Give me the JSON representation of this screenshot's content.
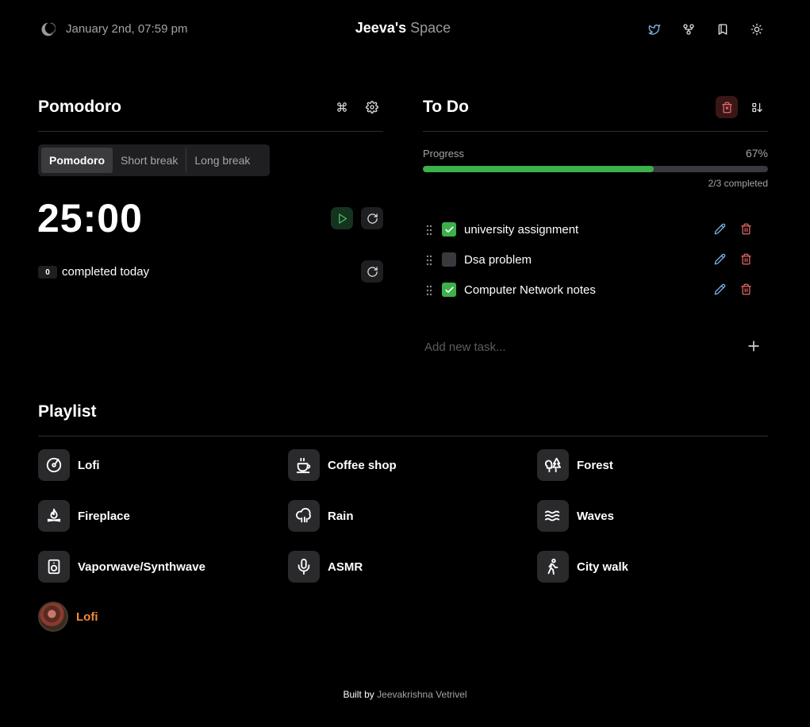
{
  "header": {
    "date": "January 2nd, 07:59 pm",
    "title_main": "Jeeva's",
    "title_sub": "Space",
    "icons": [
      "moon-logo-icon",
      "twitter-icon",
      "git-fork-icon",
      "bookmark-icon",
      "sun-icon"
    ]
  },
  "pomodoro": {
    "title": "Pomodoro",
    "tabs": [
      "Pomodoro",
      "Short break",
      "Long break"
    ],
    "active_tab": "Pomodoro",
    "timer": "25:00",
    "completed_count": "0",
    "completed_label": "completed today"
  },
  "todo": {
    "title": "To Do",
    "progress_label": "Progress",
    "progress_percent_text": "67%",
    "progress_value": 0.67,
    "completed_text": "2/3 completed",
    "tasks": [
      {
        "text": "university assignment",
        "done": true
      },
      {
        "text": "Dsa problem",
        "done": false
      },
      {
        "text": "Computer Network notes",
        "done": true
      }
    ],
    "add_placeholder": "Add new task..."
  },
  "playlist": {
    "title": "Playlist",
    "items": [
      {
        "label": "Lofi",
        "icon": "disc-icon"
      },
      {
        "label": "Coffee shop",
        "icon": "coffee-icon"
      },
      {
        "label": "Forest",
        "icon": "trees-icon"
      },
      {
        "label": "Fireplace",
        "icon": "flame-icon"
      },
      {
        "label": "Rain",
        "icon": "cloud-rain-icon"
      },
      {
        "label": "Waves",
        "icon": "waves-icon"
      },
      {
        "label": "Vaporwave/Synthwave",
        "icon": "speaker-icon"
      },
      {
        "label": "ASMR",
        "icon": "microphone-icon"
      },
      {
        "label": "City walk",
        "icon": "walking-icon"
      }
    ],
    "custom": {
      "label": "Lofi"
    }
  },
  "footer": {
    "prefix": "Built by",
    "author": "Jeevakrishna Vetrivel"
  },
  "colors": {
    "background": "#000000",
    "accent_green": "#3cb04a",
    "accent_red": "#e76b6b",
    "accent_blue": "#7eb6e8",
    "accent_orange": "#f08a3a"
  }
}
